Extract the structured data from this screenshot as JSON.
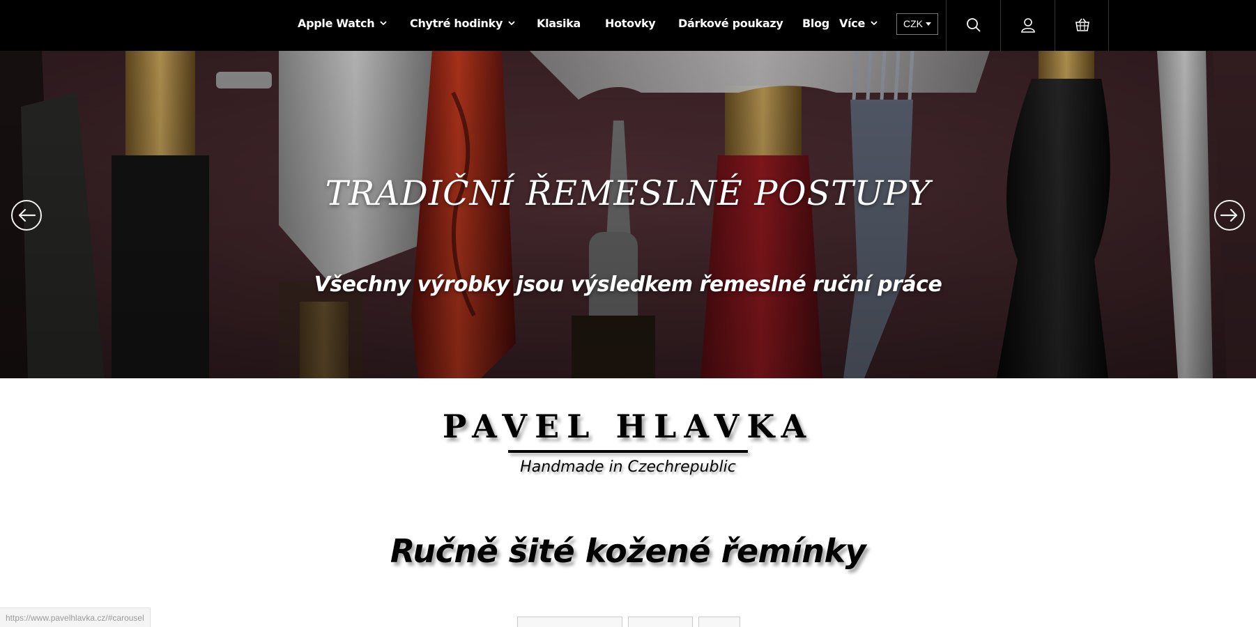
{
  "nav": {
    "items": [
      {
        "label": "Apple Watch",
        "dropdown": true
      },
      {
        "label": "Chytré hodinky",
        "dropdown": true
      },
      {
        "label": "Klasika",
        "dropdown": false
      },
      {
        "label": "Hotovky",
        "dropdown": false
      },
      {
        "label": "Dárkové poukazy",
        "dropdown": false
      },
      {
        "label": "Blog",
        "dropdown": false
      },
      {
        "label": "Více",
        "dropdown": true
      }
    ],
    "currency": "CZK",
    "icons": [
      "search-icon",
      "user-icon",
      "cart-icon"
    ]
  },
  "hero": {
    "title": "TRADIČNÍ ŘEMESLNÉ POSTUPY",
    "subtitle": "Všechny výrobky jsou výsledkem řemeslné ruční práce",
    "prev_icon": "arrow-left-icon",
    "next_icon": "arrow-right-icon"
  },
  "brand": {
    "name": "PAVEL HLAVKA",
    "tagline": "Handmade in Czechrepublic"
  },
  "section": {
    "title": "Ručně šité kožené řemínky"
  },
  "status_bar": {
    "url": "https://www.pavelhlavka.cz/#carousel"
  },
  "colors": {
    "nav_bg": "#000000",
    "hero_bg": "#4a2b30",
    "text_light": "#ffffff",
    "text_dark": "#000000"
  }
}
